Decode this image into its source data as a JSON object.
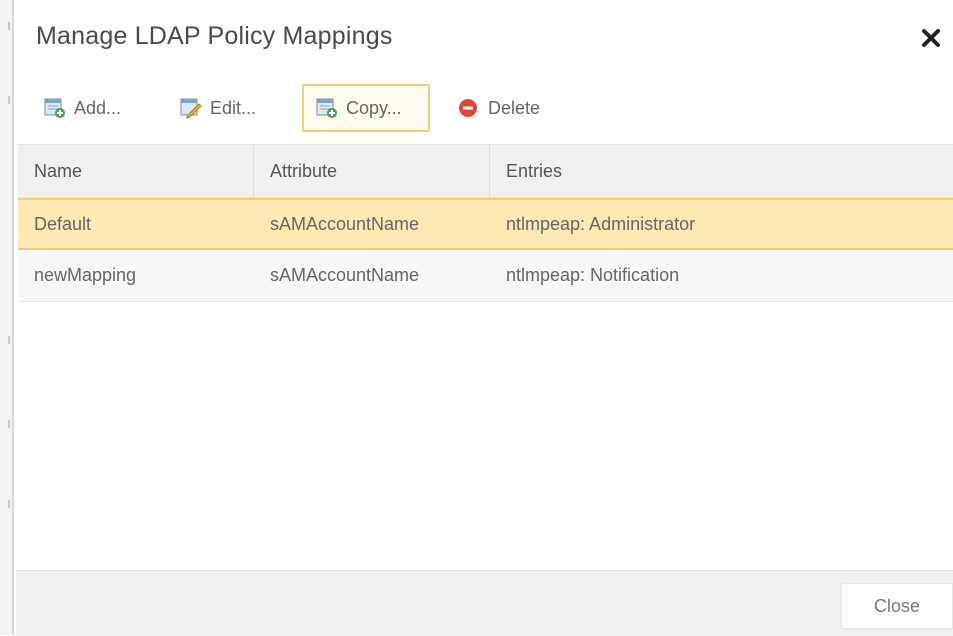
{
  "dialog": {
    "title": "Manage LDAP Policy Mappings",
    "close_icon": "close-icon"
  },
  "toolbar": {
    "add_label": "Add...",
    "edit_label": "Edit...",
    "copy_label": "Copy...",
    "delete_label": "Delete"
  },
  "grid": {
    "columns": [
      "Name",
      "Attribute",
      "Entries"
    ],
    "rows": [
      {
        "name": "Default",
        "attribute": "sAMAccountName",
        "entries": "ntlmpeap: Administrator",
        "selected": true
      },
      {
        "name": "newMapping",
        "attribute": "sAMAccountName",
        "entries": "ntlmpeap: Notification",
        "selected": false
      }
    ]
  },
  "footer": {
    "close_label": "Close"
  },
  "colors": {
    "selected_row": "#fde9b4",
    "selected_border": "#f4cf6f",
    "delete_icon": "#e0453a",
    "add_icon": "#3fa34d"
  }
}
